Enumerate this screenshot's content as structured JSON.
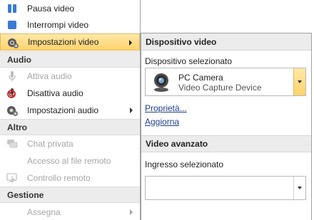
{
  "menu": {
    "pause_video": "Pausa video",
    "stop_video": "Interrompi video",
    "video_settings": "Impostazioni video",
    "section_audio": "Audio",
    "enable_audio": "Attiva audio",
    "disable_audio": "Disattiva audio",
    "audio_settings": "Impostazioni audio",
    "section_other": "Altro",
    "private_chat": "Chat privata",
    "remote_file_access": "Accesso al file remoto",
    "remote_control": "Controllo remoto",
    "section_management": "Gestione",
    "assign": "Assegna"
  },
  "panel": {
    "device_header": "Dispositivo video",
    "selected_device_label": "Dispositivo selezionato",
    "device_name": "PC Camera",
    "device_type": "Video Capture Device",
    "properties_link": "Proprietà...",
    "refresh_link": "Aggiorna",
    "advanced_header": "Video avanzato",
    "selected_input_label": "Ingresso selezionato",
    "selected_input_value": ""
  },
  "colors": {
    "highlight": "#ffd36b",
    "section_bg": "#ececec",
    "link": "#1f3f8c",
    "pause_icon": "#3a7bd5"
  }
}
